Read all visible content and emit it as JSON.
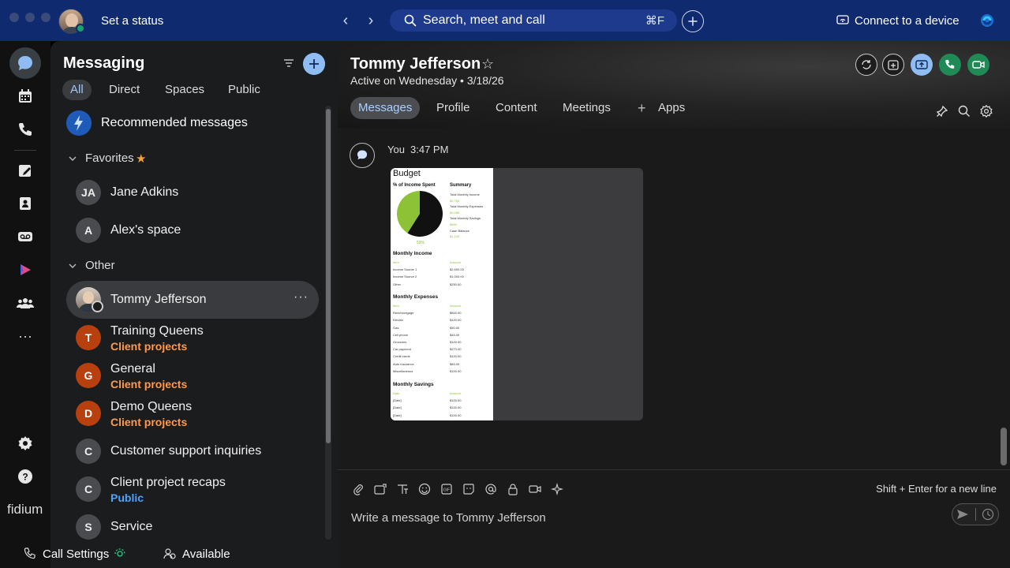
{
  "titlebar": {
    "status_label": "Set a status",
    "search_placeholder": "Search, meet and call",
    "search_shortcut": "⌘F",
    "connect_label": "Connect to a device"
  },
  "rail": {
    "items": [
      "messaging-icon",
      "calendar-icon",
      "calls-icon",
      "whiteboard-icon",
      "contacts-icon",
      "voicemail-icon",
      "webex-apps-icon",
      "teams-icon",
      "more-icon"
    ],
    "bottom": [
      "settings-icon",
      "help-icon"
    ],
    "brand": "fidium"
  },
  "messaging": {
    "title": "Messaging",
    "tabs": [
      "All",
      "Direct",
      "Spaces",
      "Public"
    ],
    "active_tab": "All",
    "recommended": "Recommended messages",
    "favorites_label": "Favorites",
    "other_label": "Other",
    "favorites": [
      {
        "initials": "JA",
        "name": "Jane Adkins"
      },
      {
        "initials": "A",
        "name": "Alex's space"
      }
    ],
    "selected": {
      "name": "Tommy Jefferson",
      "more": "···"
    },
    "other": [
      {
        "initials": "T",
        "name": "Training Queens",
        "sub": "Client projects"
      },
      {
        "initials": "G",
        "name": "General",
        "sub": "Client projects"
      },
      {
        "initials": "D",
        "name": "Demo Queens",
        "sub": "Client projects"
      },
      {
        "initials": "C",
        "name": "Customer support inquiries",
        "sub": ""
      },
      {
        "initials": "C",
        "name": "Client project recaps",
        "sub": "Public"
      },
      {
        "initials": "S",
        "name": "Service",
        "sub": ""
      }
    ],
    "call_settings": "Call Settings",
    "availability": "Available"
  },
  "conversation": {
    "name": "Tommy Jefferson",
    "status": "Active on Wednesday • 3/18/26",
    "tabs": [
      "Messages",
      "Profile",
      "Content",
      "Meetings",
      "Apps"
    ],
    "active_tab": "Messages",
    "message": {
      "sender": "You",
      "time": "3:47 PM"
    },
    "attachment": {
      "title": "Budget",
      "pie_label": "% of Income Spent",
      "pie_value": "59%",
      "summary_label": "Summary",
      "summary_rows": [
        "Total Monthly Income",
        "$2,750",
        "Total Monthly Expenses",
        "$2,058",
        "Total Monthly Savings",
        "$690",
        "Cash Balance",
        "$1,140"
      ],
      "income_label": "Monthly Income",
      "income_rows": [
        [
          "Item",
          "Amount"
        ],
        [
          "Income Source 1",
          "$2,500.00"
        ],
        [
          "Income Source 2",
          "$1,000.00"
        ],
        [
          "Other",
          "$250.00"
        ]
      ],
      "expenses_label": "Monthly Expenses",
      "expense_rows": [
        [
          "Item",
          "Amount"
        ],
        [
          "Rent/mortgage",
          "$800.00"
        ],
        [
          "Electric",
          "$120.00"
        ],
        [
          "Gas",
          "$50.00"
        ],
        [
          "Cell phone",
          "$45.00"
        ],
        [
          "Groceries",
          "$100.00"
        ],
        [
          "Car payment",
          "$273.00"
        ],
        [
          "Credit cards",
          "$120.00"
        ],
        [
          "Auto insurance",
          "$65.00"
        ],
        [
          "Miscellaneous",
          "$100.00"
        ]
      ],
      "savings_label": "Monthly Savings",
      "savings_rows": [
        [
          "Date",
          "Amount"
        ],
        [
          "[Date]",
          "$100.00"
        ],
        [
          "[Date]",
          "$100.00"
        ],
        [
          "[Date]",
          "$100.00"
        ]
      ],
      "pie": {
        "spent_fraction": 0.59,
        "spent_color": "#111111",
        "rest_color": "#8ec236"
      }
    },
    "composer_placeholder": "Write a message to Tommy Jefferson",
    "composer_hint": "Shift + Enter for a new line"
  },
  "colors": {
    "titlebar": "#0f2a6e",
    "accent_blue": "#8fbdf3",
    "call_green": "#1f8a55",
    "client_projects": "#ff9a4d",
    "public_blue": "#4aa3ff"
  }
}
